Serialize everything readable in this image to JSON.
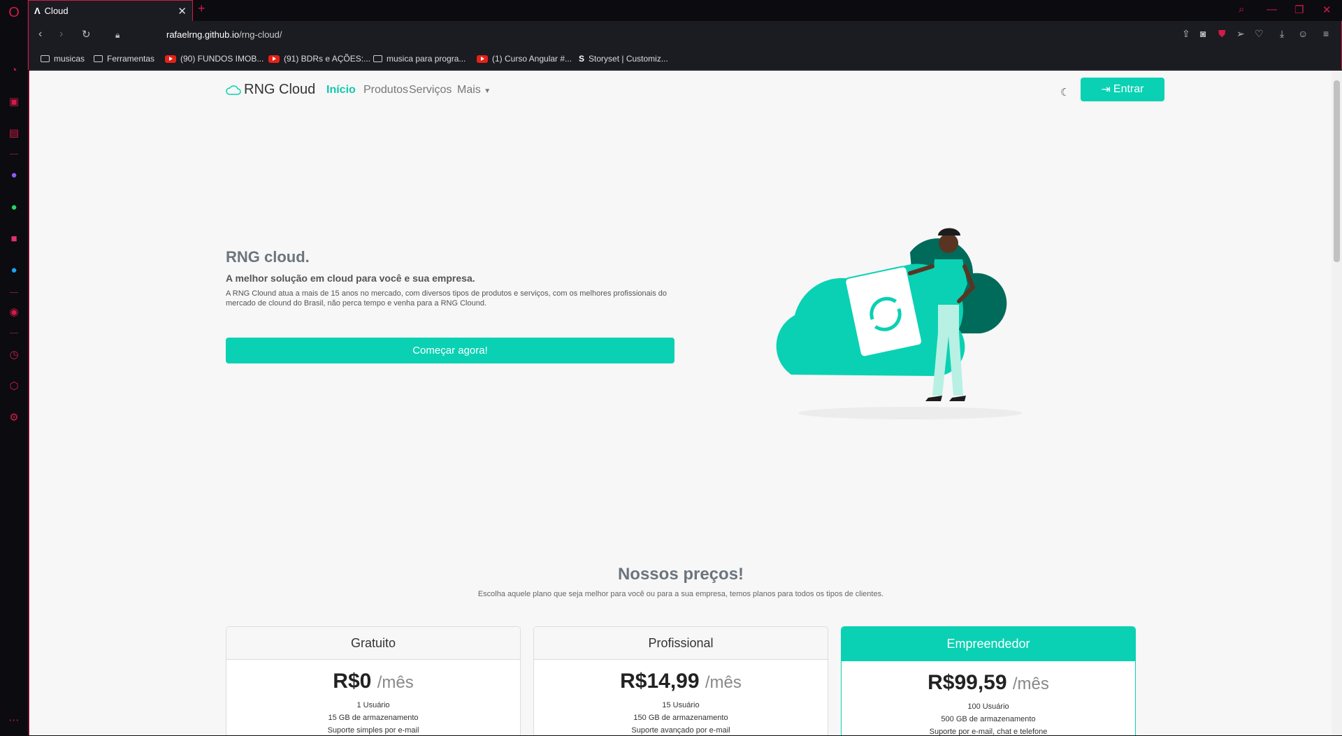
{
  "browser": {
    "tab_title": "Cloud",
    "url_host": "rafaelrng.github.io",
    "url_path": "/rng-cloud/",
    "bookmarks": [
      {
        "label": "musicas",
        "icon": "folder-icon"
      },
      {
        "label": "Ferramentas",
        "icon": "folder-icon"
      },
      {
        "label": "(90) FUNDOS IMOB...",
        "icon": "youtube-icon"
      },
      {
        "label": "(91) BDRs e AÇÕES:...",
        "icon": "youtube-icon"
      },
      {
        "label": "musica para progra...",
        "icon": "folder-icon"
      },
      {
        "label": "(1) Curso Angular #...",
        "icon": "youtube-icon"
      },
      {
        "label": "Storyset | Customiz...",
        "icon": "storyset-icon"
      }
    ]
  },
  "nav": {
    "brand": "RNG Cloud",
    "items": [
      "Início",
      "Produtos",
      "Serviços",
      "Mais"
    ],
    "login": "Entrar"
  },
  "hero": {
    "title": "RNG cloud.",
    "subtitle": "A melhor solução em cloud para você e sua empresa.",
    "text": "A RNG Clound atua a mais de 15 anos no mercado, com diversos tipos de produtos e serviços, com os melhores profissionais do mercado de clound do Brasil, não perca tempo e venha para a RNG Clound.",
    "cta": "Começar agora!"
  },
  "pricing": {
    "title": "Nossos preços!",
    "subtitle": "Escolha aquele plano que seja melhor para você ou para a sua empresa, temos planos para todos os tipos de clientes.",
    "plans": [
      {
        "name": "Gratuito",
        "price": "R$0",
        "period": "/mês",
        "f1": "1 Usuário",
        "f2": "15 GB de armazenamento",
        "f3": "Suporte simples por e-mail"
      },
      {
        "name": "Profissional",
        "price": "R$14,99",
        "period": "/mês",
        "f1": "15 Usuário",
        "f2": "150 GB de armazenamento",
        "f3": "Suporte avançado por e-mail"
      },
      {
        "name": "Empreendedor",
        "price": "R$99,59",
        "period": "/mês",
        "f1": "100 Usuário",
        "f2": "500 GB de armazenamento",
        "f3": "Suporte por e-mail, chat e telefone"
      }
    ]
  },
  "colors": {
    "accent": "#0ad1b3",
    "browser_accent": "#d21b46"
  }
}
